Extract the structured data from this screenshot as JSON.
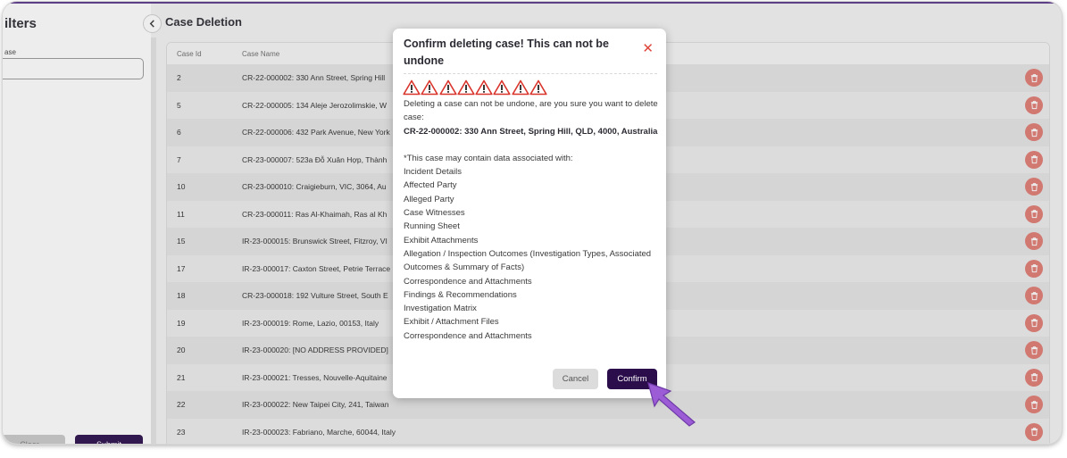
{
  "filters": {
    "title": "ilters",
    "case_label": "ase",
    "case_input_value": "",
    "clear_label": "Clear",
    "submit_label": "Submit"
  },
  "page": {
    "title": "Case Deletion",
    "collapse_icon": "chevron-left-icon"
  },
  "table": {
    "columns": [
      "Case Id",
      "Case Name"
    ],
    "rows": [
      {
        "id": "2",
        "name": "CR-22-000002: 330 Ann Street, Spring Hill"
      },
      {
        "id": "5",
        "name": "CR-22-000005: 134 Aleje Jerozolimskie, W"
      },
      {
        "id": "6",
        "name": "CR-22-000006: 432 Park Avenue, New York"
      },
      {
        "id": "7",
        "name": "CR-23-000007: 523a Đỗ Xuân Hợp, Thành"
      },
      {
        "id": "10",
        "name": "CR-23-000010: Craigieburn, VIC, 3064, Au"
      },
      {
        "id": "11",
        "name": "CR-23-000011: Ras Al-Khaimah, Ras al Kh"
      },
      {
        "id": "15",
        "name": "IR-23-000015: Brunswick Street, Fitzroy, VI"
      },
      {
        "id": "17",
        "name": "IR-23-000017: Caxton Street, Petrie Terrace"
      },
      {
        "id": "18",
        "name": "CR-23-000018: 192 Vulture Street, South E"
      },
      {
        "id": "19",
        "name": "IR-23-000019: Rome, Lazio, 00153, Italy"
      },
      {
        "id": "20",
        "name": "IR-23-000020: [NO ADDRESS PROVIDED]"
      },
      {
        "id": "21",
        "name": "IR-23-000021: Tresses, Nouvelle-Aquitaine"
      },
      {
        "id": "22",
        "name": "IR-23-000022: New Taipei City, 241, Taiwan"
      },
      {
        "id": "23",
        "name": "IR-23-000023: Fabriano, Marche, 60044, Italy"
      }
    ]
  },
  "modal": {
    "title": "Confirm deleting case! This can not be undone",
    "close_icon": "close-icon",
    "warning_icon": "warning-triangle-icon",
    "warning_count": 8,
    "intro": "Deleting a case can not be undone, are you sure you want to delete case:",
    "case_name": "CR-22-000002: 330 Ann Street, Spring Hill, QLD, 4000, Australia",
    "data_note": "*This case may contain data associated with:",
    "data_items": [
      "Incident Details",
      "Affected Party",
      "Alleged Party",
      "Case Witnesses",
      "Running Sheet",
      "Exhibit Attachments",
      "Allegation / Inspection Outcomes (Investigation Types, Associated Outcomes & Summary of Facts)",
      "Correspondence and Attachments",
      "Findings & Recommendations",
      "Investigation Matrix",
      "Exhibit / Attachment Files",
      "Correspondence and Attachments"
    ],
    "cancel_label": "Cancel",
    "confirm_label": "Confirm"
  },
  "colors": {
    "accent_dark": "#2a0d4a",
    "delete_red": "#e07a72",
    "warning_red": "#d9342b",
    "cursor_purple": "#9b5cd6"
  },
  "cursor_icon": "pointer-arrow-icon"
}
